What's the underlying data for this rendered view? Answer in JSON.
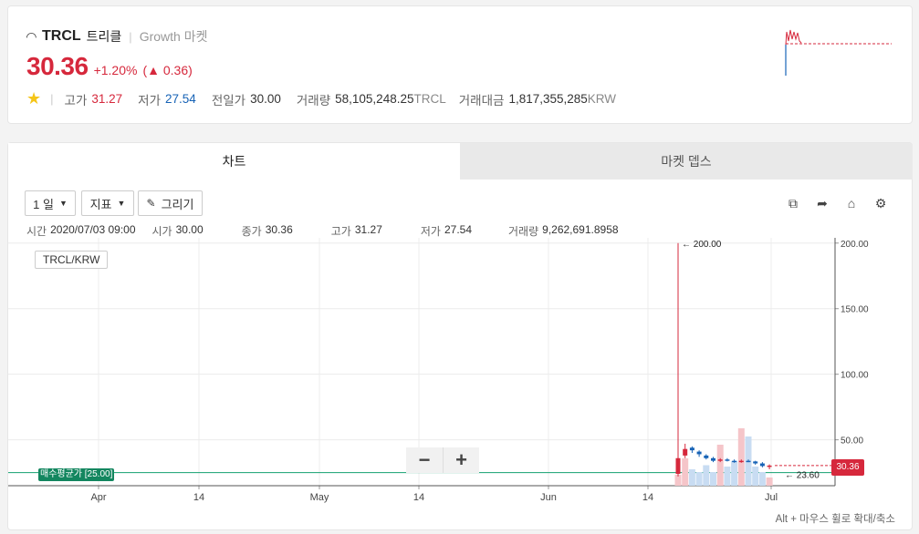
{
  "ticker": {
    "symbol": "TRCL",
    "korean_name": "트리클",
    "market": "Growth 마켓",
    "price": "30.36",
    "change_pct": "+1.20%",
    "change_abs": "(▲ 0.36)",
    "accent_up": "#d6283c",
    "accent_down": "#1763b6",
    "stats": {
      "high_label": "고가",
      "high": "31.27",
      "low_label": "저가",
      "low": "27.54",
      "prev_label": "전일가",
      "prev": "30.00",
      "volume_label": "거래량",
      "volume": "58,105,248.25",
      "volume_unit": "TRCL",
      "value_label": "거래대금",
      "value": "1,817,355,285",
      "value_unit": "KRW"
    }
  },
  "tabs": {
    "chart": "차트",
    "depth": "마켓 뎁스"
  },
  "toolbar": {
    "interval": "1 일",
    "indicator": "지표",
    "draw": "그리기",
    "icons": [
      "external-link-icon",
      "share-icon",
      "tag-icon",
      "settings-icon"
    ]
  },
  "info": {
    "time_label": "시간",
    "time": "2020/07/03 09:00",
    "open_label": "시가",
    "open": "30.00",
    "close_label": "종가",
    "close": "30.36",
    "high_label": "고가",
    "high": "31.27",
    "low_label": "저가",
    "low": "27.54",
    "vol_label": "거래량",
    "vol": "9,262,691.8958"
  },
  "chart": {
    "pair": "TRCL/KRW",
    "avg_tag": "매수평균가 [25.00]",
    "last_price_tag": "30.36",
    "max_marker": "← 200.00",
    "min_marker": "← 23.60",
    "hint": "Alt + 마우스 휠로 확대/축소",
    "zoom_out": "−",
    "zoom_in": "+"
  },
  "chart_data": {
    "type": "candlestick",
    "y_ticks": [
      "200.00",
      "150.00",
      "100.00",
      "50.00"
    ],
    "ylim": [
      15,
      204
    ],
    "x_ticks": [
      "Apr",
      "14",
      "May",
      "14",
      "Jun",
      "14",
      "Jul"
    ],
    "average_buy_price": 25.0,
    "last_price": 30.36,
    "annotated_high": 200.0,
    "annotated_low": 23.6,
    "candles": [
      {
        "o": 24.0,
        "h": 200.0,
        "l": 22.0,
        "c": 36.0,
        "dir": "up"
      },
      {
        "o": 38.0,
        "h": 47.0,
        "l": 36.0,
        "c": 43.0,
        "dir": "up"
      },
      {
        "o": 44.0,
        "h": 45.0,
        "l": 40.0,
        "c": 42.0,
        "dir": "down"
      },
      {
        "o": 41.0,
        "h": 42.0,
        "l": 37.0,
        "c": 39.0,
        "dir": "down"
      },
      {
        "o": 38.0,
        "h": 39.0,
        "l": 35.0,
        "c": 36.0,
        "dir": "down"
      },
      {
        "o": 36.0,
        "h": 37.0,
        "l": 33.0,
        "c": 34.0,
        "dir": "down"
      },
      {
        "o": 34.0,
        "h": 36.0,
        "l": 33.0,
        "c": 35.0,
        "dir": "up"
      },
      {
        "o": 35.0,
        "h": 36.0,
        "l": 33.5,
        "c": 34.0,
        "dir": "down"
      },
      {
        "o": 34.0,
        "h": 35.0,
        "l": 32.5,
        "c": 33.0,
        "dir": "down"
      },
      {
        "o": 33.0,
        "h": 35.0,
        "l": 32.5,
        "c": 34.0,
        "dir": "up"
      },
      {
        "o": 34.0,
        "h": 35.0,
        "l": 33.0,
        "c": 33.5,
        "dir": "down"
      },
      {
        "o": 33.5,
        "h": 34.0,
        "l": 31.0,
        "c": 32.0,
        "dir": "down"
      },
      {
        "o": 32.0,
        "h": 33.0,
        "l": 29.0,
        "c": 30.0,
        "dir": "down"
      },
      {
        "o": 30.0,
        "h": 31.27,
        "l": 27.54,
        "c": 30.36,
        "dir": "up"
      }
    ],
    "volumes": [
      0.08,
      0.2,
      0.12,
      0.1,
      0.15,
      0.1,
      0.3,
      0.14,
      0.18,
      0.42,
      0.36,
      0.14,
      0.1,
      0.06
    ]
  }
}
